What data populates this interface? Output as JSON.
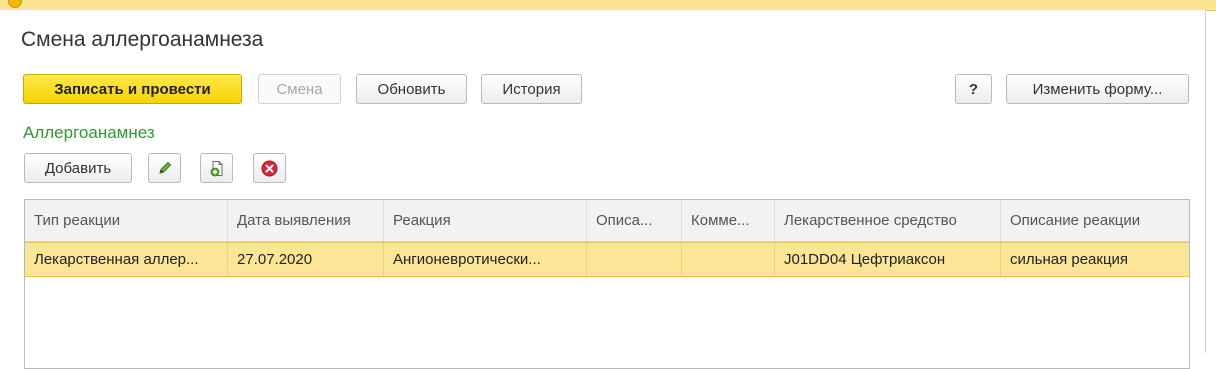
{
  "window": {
    "title": "Смена аллергоанамнеза"
  },
  "toolbar": {
    "save_post": "Записать и провести",
    "change": "Смена",
    "refresh": "Обновить",
    "history": "История",
    "help": "?",
    "change_form": "Изменить форму..."
  },
  "section": {
    "title": "Аллергоанамнез",
    "add": "Добавить"
  },
  "table": {
    "columns": [
      "Тип реакции",
      "Дата выявления",
      "Реакция",
      "Описа...",
      "Комме...",
      "Лекарственное средство",
      "Описание реакции"
    ],
    "rows": [
      [
        "Лекарственная аллер...",
        "27.07.2020",
        "Ангионевротически...",
        "",
        "",
        "J01DD04 Цефтриаксон",
        "сильная реакция"
      ]
    ]
  },
  "colors": {
    "primary_button": "#f5d300",
    "section_title": "#2e9a2e",
    "selected_row": "#fbe596",
    "delete_icon": "#d9263a",
    "edit_icon": "#5a9f2a"
  }
}
